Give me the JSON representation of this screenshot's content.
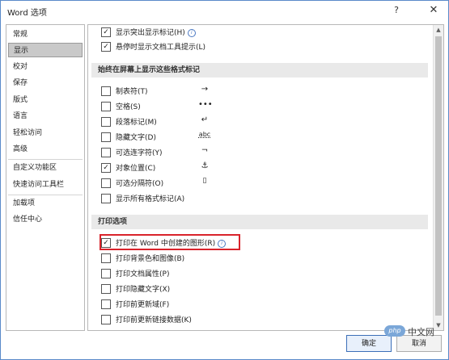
{
  "window": {
    "title": "Word 选项",
    "help": "?",
    "close": "✕"
  },
  "sidebar": {
    "items": [
      {
        "label": "常规"
      },
      {
        "label": "显示"
      },
      {
        "label": "校对"
      },
      {
        "label": "保存"
      },
      {
        "label": "版式"
      },
      {
        "label": "语言"
      },
      {
        "label": "轻松访问"
      },
      {
        "label": "高级"
      },
      {
        "label": "自定义功能区"
      },
      {
        "label": "快速访问工具栏"
      },
      {
        "label": "加载项"
      },
      {
        "label": "信任中心"
      }
    ],
    "selected": "显示"
  },
  "content": {
    "top_rows": [
      {
        "label": "显示突出显示标记(H)",
        "checked": true,
        "info": true
      },
      {
        "label": "悬停时显示文档工具提示(L)",
        "checked": true,
        "info": false
      }
    ],
    "section_formatting": {
      "title": "始终在屏幕上显示这些格式标记",
      "rows": [
        {
          "label": "制表符(T)",
          "symbol": "→",
          "checked": false
        },
        {
          "label": "空格(S)",
          "symbol": "•••",
          "checked": false
        },
        {
          "label": "段落标记(M)",
          "symbol": "↵",
          "checked": false
        },
        {
          "label": "隐藏文字(D)",
          "symbol": "abc",
          "checked": false
        },
        {
          "label": "可选连字符(Y)",
          "symbol": "¬",
          "checked": false
        },
        {
          "label": "对象位置(C)",
          "symbol": "⚓",
          "checked": true
        },
        {
          "label": "可选分隔符(O)",
          "symbol": "▯",
          "checked": false
        },
        {
          "label": "显示所有格式标记(A)",
          "symbol": "",
          "checked": false
        }
      ]
    },
    "section_print": {
      "title": "打印选项",
      "rows": [
        {
          "label": "打印在 Word 中创建的图形(R)",
          "checked": true,
          "info": true
        },
        {
          "label": "打印背景色和图像(B)",
          "checked": false
        },
        {
          "label": "打印文档属性(P)",
          "checked": false
        },
        {
          "label": "打印隐藏文字(X)",
          "checked": false
        },
        {
          "label": "打印前更新域(F)",
          "checked": false
        },
        {
          "label": "打印前更新链接数据(K)",
          "checked": false
        }
      ]
    }
  },
  "buttons": {
    "ok": "确定",
    "cancel": "取消"
  },
  "watermark": {
    "logo": "php",
    "text": "中文网"
  },
  "icons": {
    "checkmark": "✓",
    "info": "i",
    "scroll_up": "▲",
    "scroll_down": "▼"
  }
}
